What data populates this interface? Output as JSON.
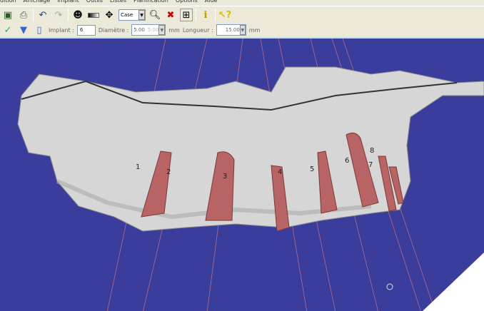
{
  "menu": [
    "dition",
    "Affichage",
    "Implant",
    "Outils",
    "Listes",
    "Planification",
    "Options",
    "Aide"
  ],
  "toolbar": {
    "icons": [
      "save-icon",
      "print-icon",
      "undo-icon",
      "redo-icon",
      "face-icon",
      "gradient-icon",
      "move-icon",
      "zoom-icon",
      "delete-icon",
      "layout-icon",
      "info-icon",
      "help-cursor-icon"
    ],
    "view_select": "Case"
  },
  "implant_bar": {
    "implant_label": "Implant :",
    "implant_value": "6",
    "diameter_label": "Diamètre :",
    "diameter_value": "5.00",
    "diameter_value2": "5.00",
    "diameter_unit": "mm",
    "length_label": "Longueur :",
    "length_value": "15.00",
    "length_unit": "mm",
    "unit_extra": "mm"
  },
  "view": {
    "background": "#3b3d9c",
    "implant_color": "#b86464",
    "implants": [
      "1",
      "2",
      "3",
      "4",
      "5",
      "6",
      "7",
      "8"
    ]
  }
}
